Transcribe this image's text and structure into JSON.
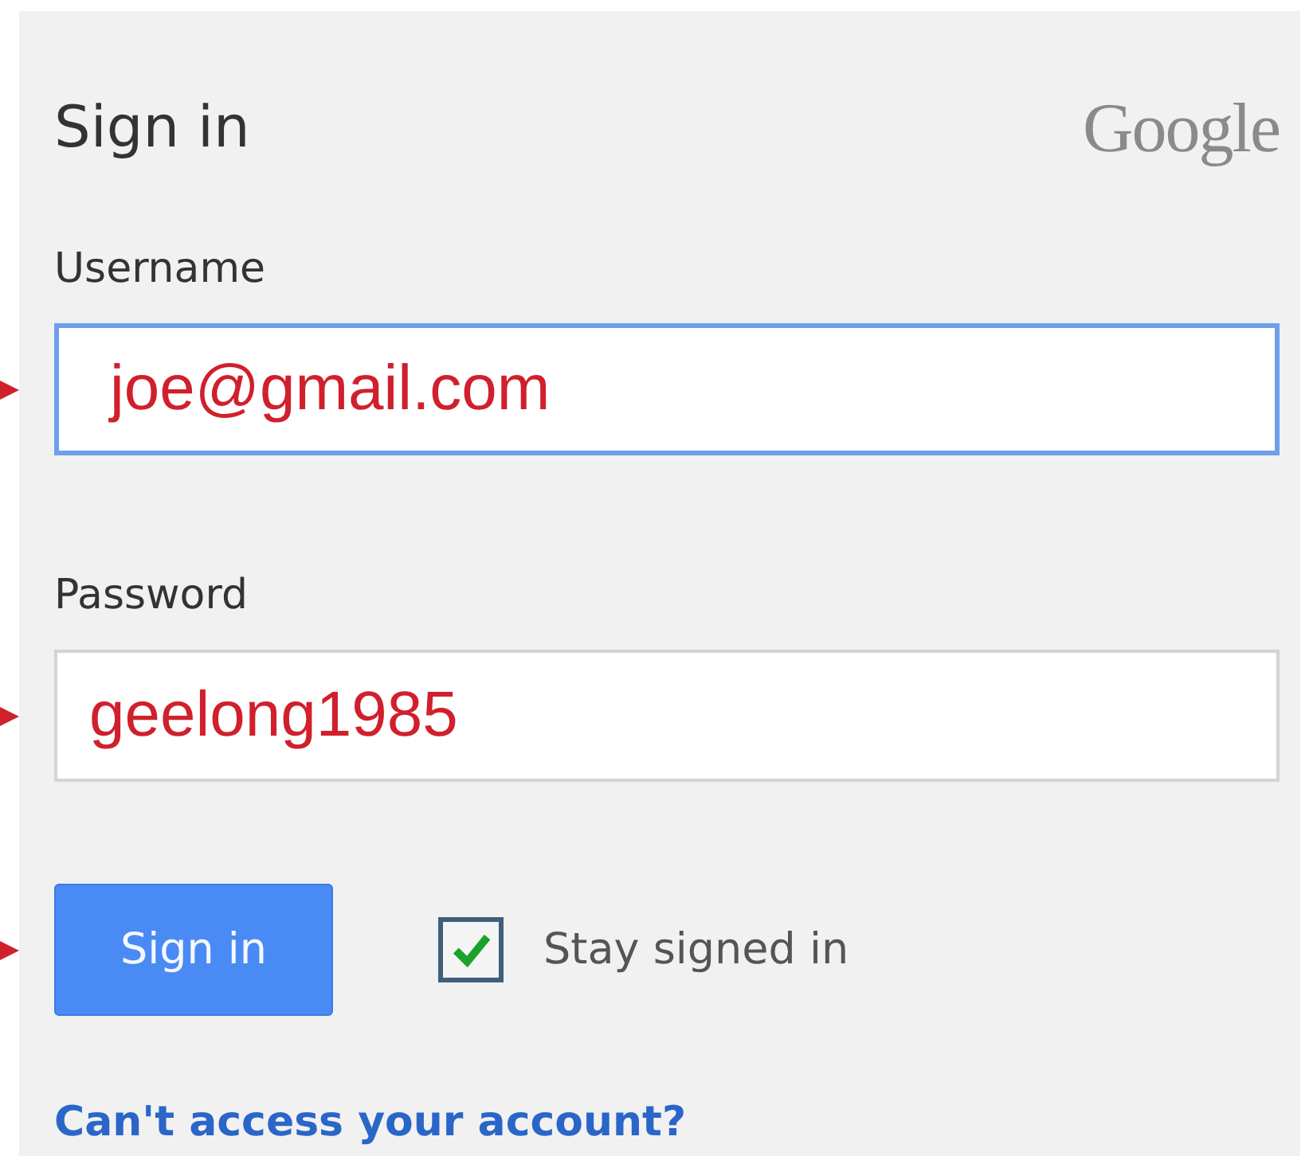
{
  "header": {
    "title": "Sign in",
    "logo": "Google"
  },
  "fields": [
    {
      "label": "Username",
      "value": "joe@gmail.com",
      "focused": true,
      "marked": true
    },
    {
      "label": "Password",
      "value": "geelong1985",
      "focused": false,
      "marked": true
    }
  ],
  "sign_in_button": {
    "label": "Sign in",
    "marked": true
  },
  "stay_signed_in": {
    "label": "Stay signed in",
    "checked": true
  },
  "help_link": "Can't access your account?"
}
